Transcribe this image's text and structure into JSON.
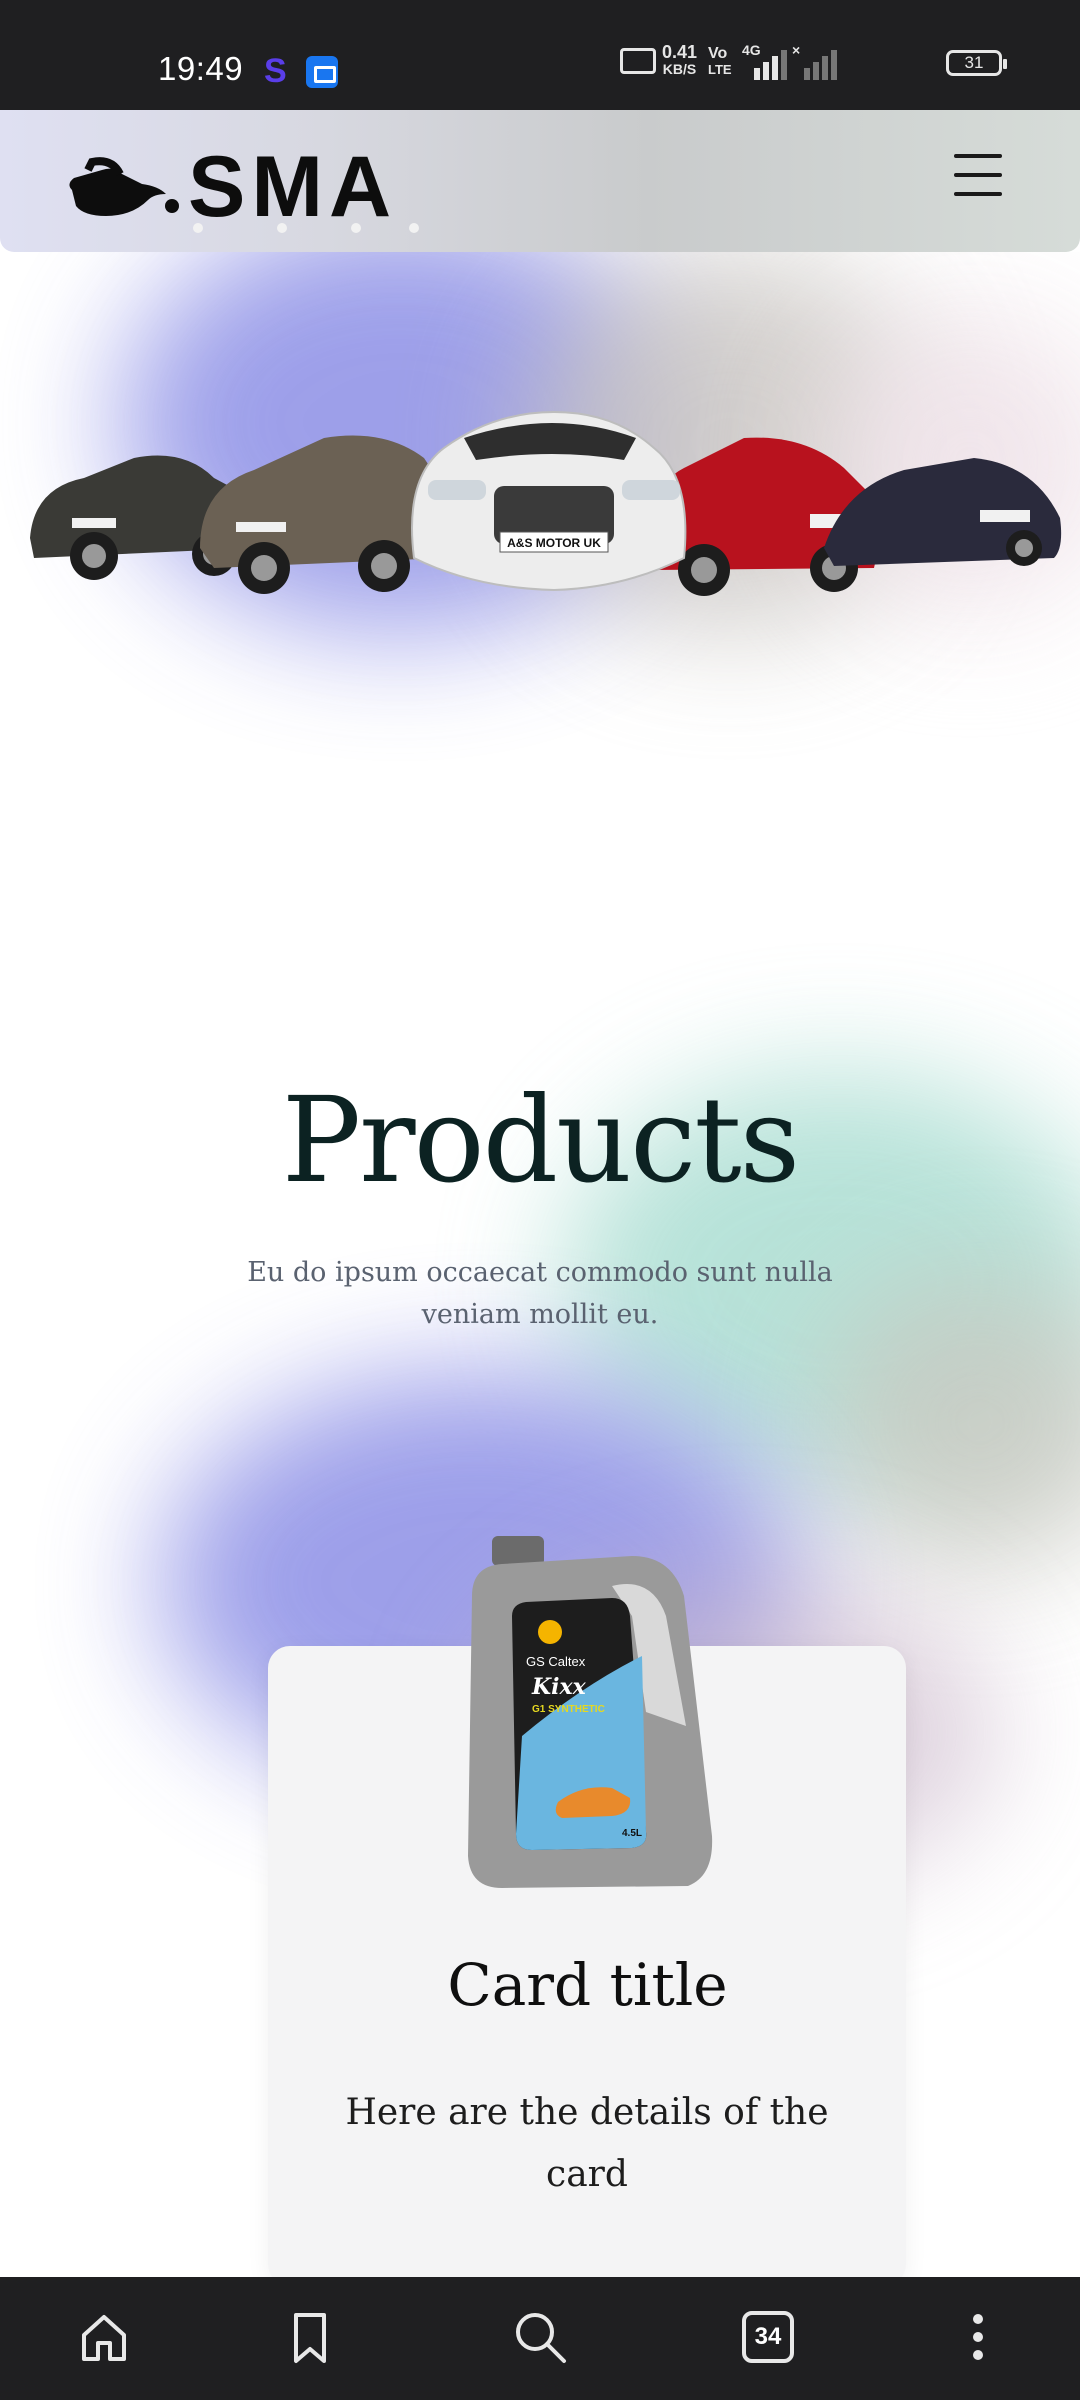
{
  "status_bar": {
    "time": "19:49",
    "net_speed_value": "0.41",
    "net_speed_unit": "KB/S",
    "volte_top": "Vo",
    "volte_bottom": "LTE",
    "network_type": "4G",
    "battery": "31"
  },
  "header": {
    "logo_text": "SMA",
    "menu_icon": "hamburger-icon"
  },
  "hero": {
    "image": "cars-lineup",
    "plate_text": "A&S MOTOR UK"
  },
  "products": {
    "title": "Products",
    "subtitle": "Eu do ipsum occaecat commodo sunt nulla veniam mollit eu."
  },
  "card": {
    "title": "Card title",
    "text": "Here are the details of the card",
    "product_brand": "GS Caltex",
    "product_name": "Kixx",
    "product_line": "G1 SYNTHETIC",
    "product_volume": "4.5L"
  },
  "bottom_nav": {
    "tab_count": "34",
    "icons": [
      "home-icon",
      "bookmark-icon",
      "search-icon",
      "tabs-icon",
      "more-vertical-icon"
    ]
  },
  "colors": {
    "status_bg": "#1f1f21",
    "title": "#0c2222",
    "card_bg": "#f4f4f5"
  }
}
